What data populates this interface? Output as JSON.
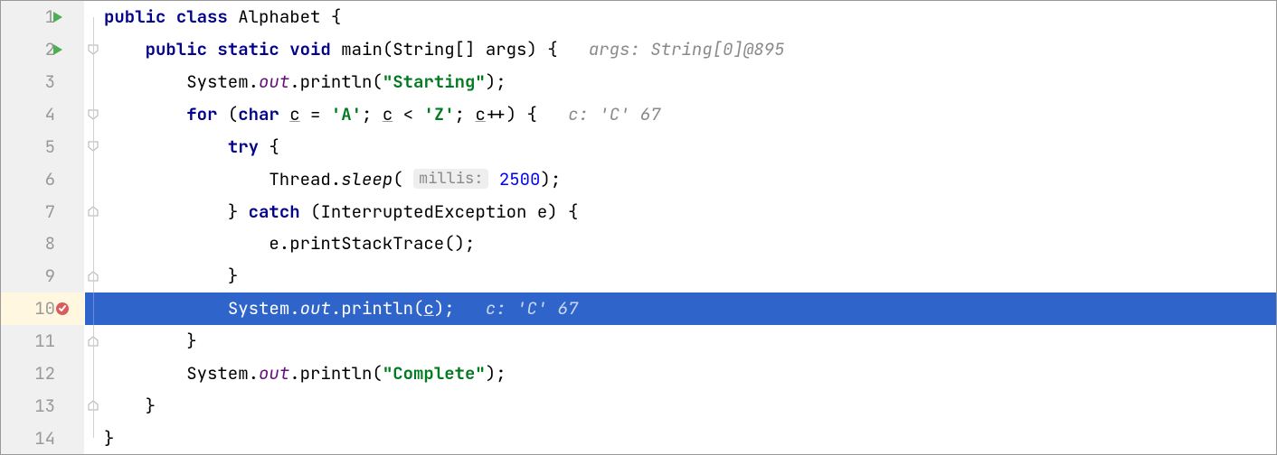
{
  "lines": {
    "l1": {
      "num": "1"
    },
    "l2": {
      "num": "2"
    },
    "l3": {
      "num": "3"
    },
    "l4": {
      "num": "4"
    },
    "l5": {
      "num": "5"
    },
    "l6": {
      "num": "6"
    },
    "l7": {
      "num": "7"
    },
    "l8": {
      "num": "8"
    },
    "l9": {
      "num": "9"
    },
    "l10": {
      "num": "10"
    },
    "l11": {
      "num": "11"
    },
    "l12": {
      "num": "12"
    },
    "l13": {
      "num": "13"
    },
    "l14": {
      "num": "14"
    }
  },
  "code": {
    "l1": {
      "kw1": "public",
      "kw2": "class",
      "name": "Alphabet",
      "brace": " {"
    },
    "l2": {
      "kw1": "public",
      "kw2": "static",
      "kw3": "void",
      "name": "main",
      "params": "(String[] args) {",
      "hint": "args: String[0]@895"
    },
    "l3": {
      "pre": "System.",
      "field": "out",
      "post": ".println(",
      "str": "\"Starting\"",
      "close": ");"
    },
    "l4": {
      "kw1": "for",
      "open": " (",
      "kw2": "char",
      "var": "c",
      "eq": " = ",
      "lit1": "'A'",
      "sep1": "; ",
      "var2": "c",
      "cmp": " < ",
      "lit2": "'Z'",
      "sep2": "; ",
      "var3": "c",
      "inc": "++) {",
      "hint": "c: 'C' 67"
    },
    "l5": {
      "kw": "try",
      "brace": " {"
    },
    "l6": {
      "pre": "Thread.",
      "method": "sleep",
      "open": "(",
      "param": "millis:",
      "num": "2500",
      "close": ");"
    },
    "l7": {
      "brace": "} ",
      "kw": "catch",
      "params": " (InterruptedException e) {"
    },
    "l8": {
      "text": "e.printStackTrace();"
    },
    "l9": {
      "brace": "}"
    },
    "l10": {
      "pre": "System.",
      "field": "out",
      "post": ".println(",
      "var": "c",
      "close": ");",
      "hint": "c: 'C' 67"
    },
    "l11": {
      "brace": "}"
    },
    "l12": {
      "pre": "System.",
      "field": "out",
      "post": ".println(",
      "str": "\"Complete\"",
      "close": ");"
    },
    "l13": {
      "brace": "}"
    },
    "l14": {
      "brace": "}"
    }
  }
}
